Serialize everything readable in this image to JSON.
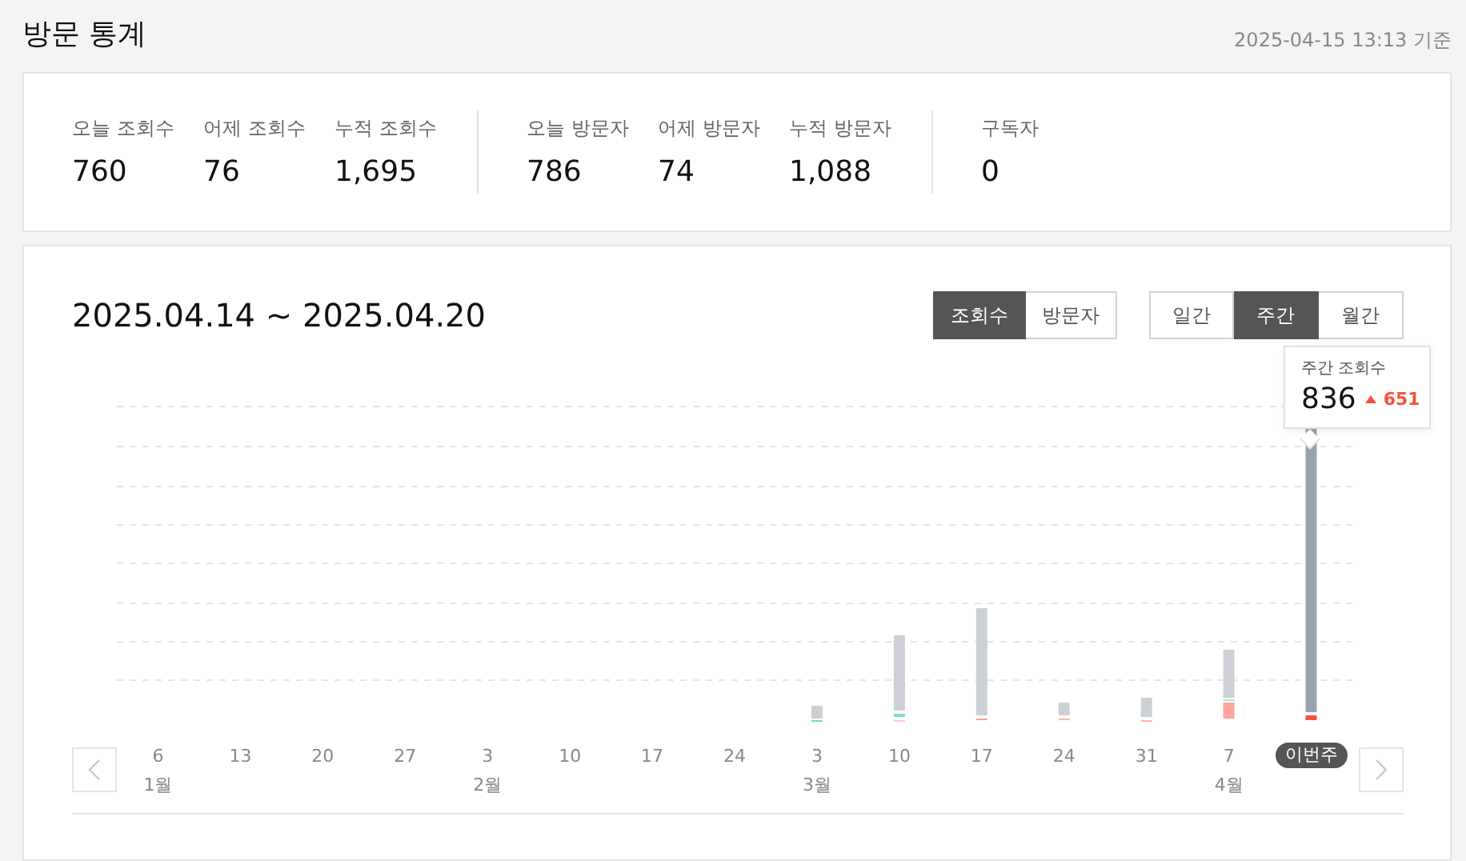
{
  "header": {
    "title": "방문 통계",
    "timestamp": "2025-04-15 13:13 기준"
  },
  "stats": [
    [
      {
        "label": "오늘 조회수",
        "value": "760"
      },
      {
        "label": "어제 조회수",
        "value": "76"
      },
      {
        "label": "누적 조회수",
        "value": "1,695"
      }
    ],
    [
      {
        "label": "오늘 방문자",
        "value": "786"
      },
      {
        "label": "어제 방문자",
        "value": "74"
      },
      {
        "label": "누적 방문자",
        "value": "1,088"
      }
    ],
    [
      {
        "label": "구독자",
        "value": "0"
      }
    ]
  ],
  "chart_panel": {
    "range": "2025.04.14 ~ 2025.04.20",
    "metric_tabs": [
      {
        "label": "조회수",
        "selected": true
      },
      {
        "label": "방문자",
        "selected": false
      }
    ],
    "period_tabs": [
      {
        "label": "일간",
        "selected": false
      },
      {
        "label": "주간",
        "selected": true
      },
      {
        "label": "월간",
        "selected": false
      }
    ],
    "tooltip": {
      "label": "주간 조회수",
      "value": "836",
      "change": "651"
    },
    "x_labels": [
      {
        "day": "6",
        "month": "1월",
        "current": false
      },
      {
        "day": "13",
        "current": false
      },
      {
        "day": "20",
        "current": false
      },
      {
        "day": "27",
        "current": false
      },
      {
        "day": "3",
        "month": "2월",
        "current": false
      },
      {
        "day": "10",
        "current": false
      },
      {
        "day": "17",
        "current": false
      },
      {
        "day": "24",
        "current": false
      },
      {
        "day": "3",
        "month": "3월",
        "current": false
      },
      {
        "day": "10",
        "current": false
      },
      {
        "day": "17",
        "current": false
      },
      {
        "day": "24",
        "current": false
      },
      {
        "day": "31",
        "current": false
      },
      {
        "day": "7",
        "month": "4월",
        "current": false
      },
      {
        "day": "이번주",
        "current": true
      }
    ]
  }
}
